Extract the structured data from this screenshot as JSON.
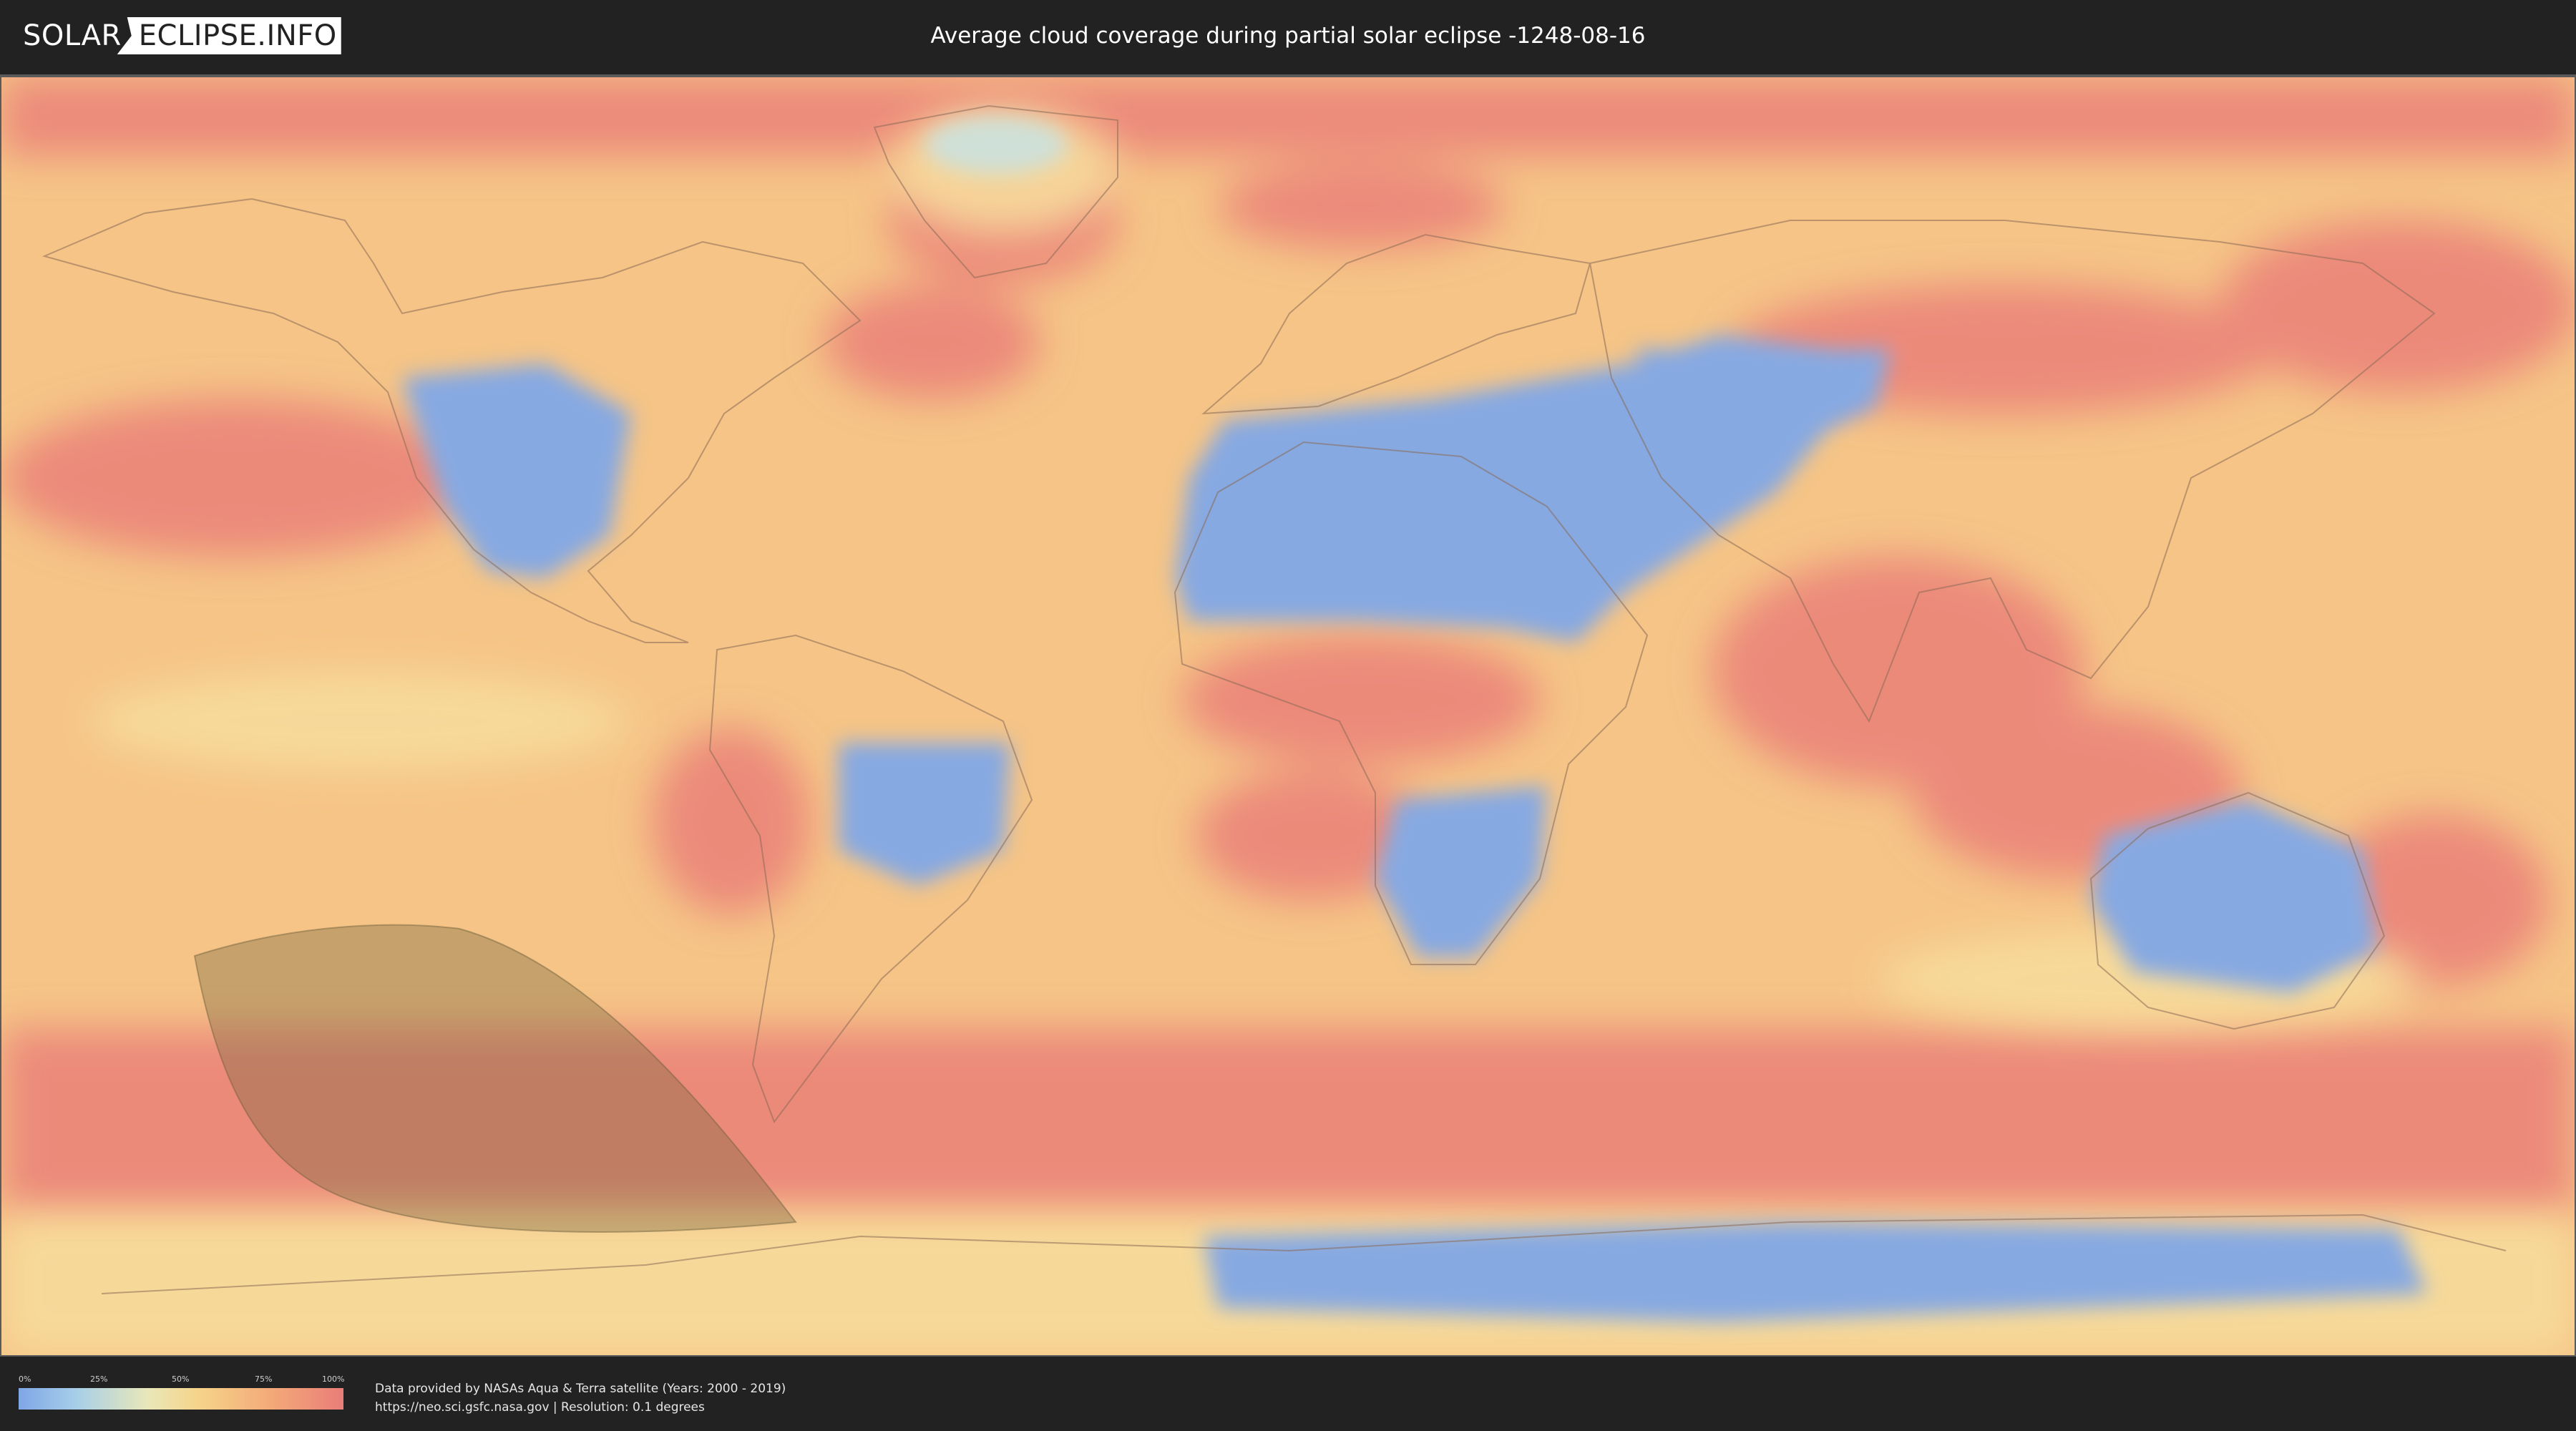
{
  "header": {
    "logo_left": "SOLAR",
    "logo_right": "ECLIPSE.INFO",
    "title": "Average cloud coverage during partial solar eclipse -1248-08-16"
  },
  "legend": {
    "ticks": [
      "0%",
      "25%",
      "50%",
      "75%",
      "100%"
    ],
    "colors": [
      "#7fa6e6",
      "#a8cfe8",
      "#e9e7b8",
      "#f6d48a",
      "#f3a978",
      "#ea7d78"
    ]
  },
  "credits": {
    "line1": "Data provided by NASAs Aqua & Terra satellite (Years: 2000 - 2019)",
    "line2": "https://neo.sci.gsfc.nasa.gov | Resolution: 0.1 degrees"
  },
  "map": {
    "colors": {
      "clear": "#7fa6e6",
      "light": "#a8cfe8",
      "mid": "#f6d48a",
      "heavy": "#ea7d78",
      "eclipse_shadow": "#7a6a40",
      "coastline": "#8a6a55"
    }
  }
}
